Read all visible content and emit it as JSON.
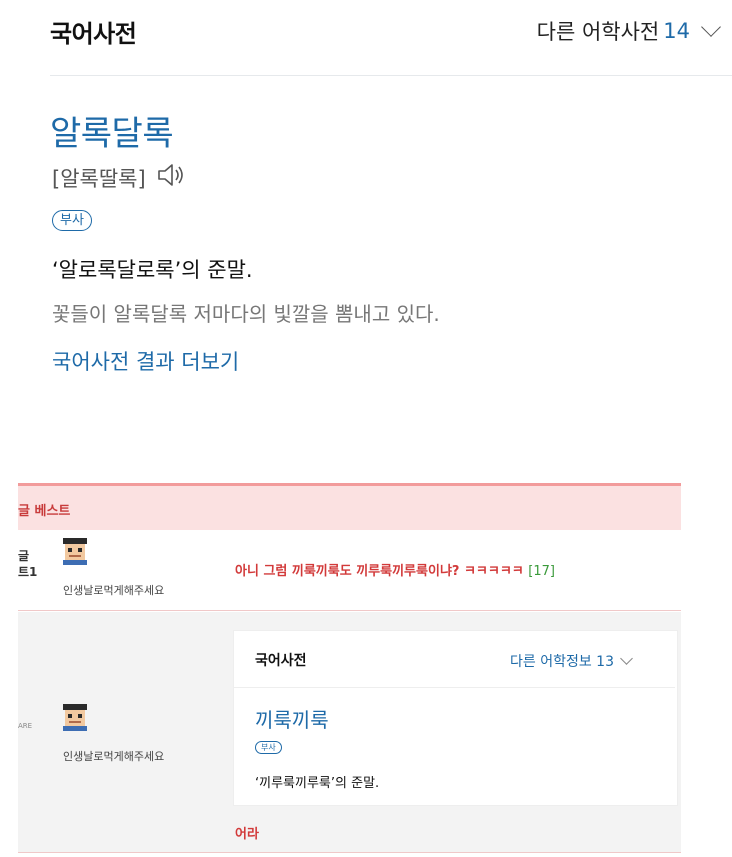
{
  "dictionary": {
    "title": "국어사전",
    "other_label": "다른 어학사전",
    "other_count": "14",
    "headword": "알록달록",
    "pronunciation": "[알록딸록]",
    "part_of_speech": "부사",
    "definition": "‘알로록달로록’의 준말.",
    "example": "꽃들이 알록달록 저마다의 빛깔을 뽐내고 있다.",
    "more_link": "국어사전 결과 더보기",
    "accent_color": "#1e6aa8"
  },
  "comments": {
    "best_label": "글 베스트",
    "rank_label_line1": "글",
    "rank_label_line2": "트1",
    "first": {
      "nickname": "인생날로먹게해주세요",
      "text": "아니 그럼 끼룩끼룩도 끼루룩끼루룩이냐? ㅋㅋㅋㅋㅋ",
      "count": "[17]"
    },
    "second": {
      "side_label": "ARE",
      "nickname": "인생날로먹게해주세요",
      "card": {
        "title": "국어사전",
        "other_label": "다른 어학정보 13",
        "headword": "끼룩끼룩",
        "part_of_speech": "부사",
        "definition": "‘끼루룩끼루룩’의 준말."
      },
      "reply": "어라"
    },
    "highlight_color": "#d23a3a"
  }
}
